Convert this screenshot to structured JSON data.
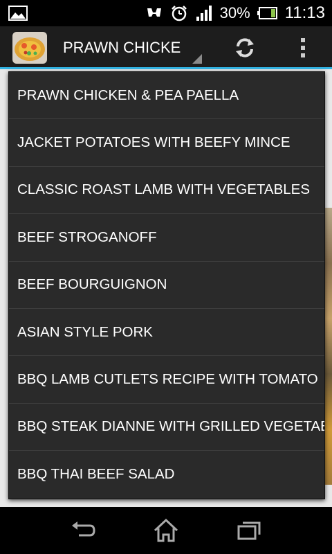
{
  "status_bar": {
    "battery_percent": "30%",
    "time": "11:13"
  },
  "action_bar": {
    "spinner_selected": "PRAWN CHICKEN & PEA PAELLA",
    "icons": [
      "recipe-thumbnail",
      "refresh-icon",
      "overflow-menu-icon"
    ]
  },
  "dropdown": {
    "items": [
      "PRAWN CHICKEN & PEA PAELLA",
      "JACKET POTATOES WITH BEEFY MINCE",
      "CLASSIC ROAST LAMB WITH VEGETABLES",
      "BEEF STROGANOFF",
      "BEEF BOURGUIGNON",
      "ASIAN STYLE PORK",
      "BBQ LAMB CUTLETS RECIPE WITH TOMATO",
      "BBQ STEAK DIANNE WITH GRILLED VEGETABLES",
      "BBQ THAI BEEF SALAD"
    ]
  },
  "nav_bar": {
    "icons": [
      "back-icon",
      "home-icon",
      "recent-apps-icon"
    ]
  },
  "colors": {
    "accent": "#33b5e5",
    "action_bar": "#1d1d1d",
    "dropdown_bg": "#2a2a2a"
  }
}
